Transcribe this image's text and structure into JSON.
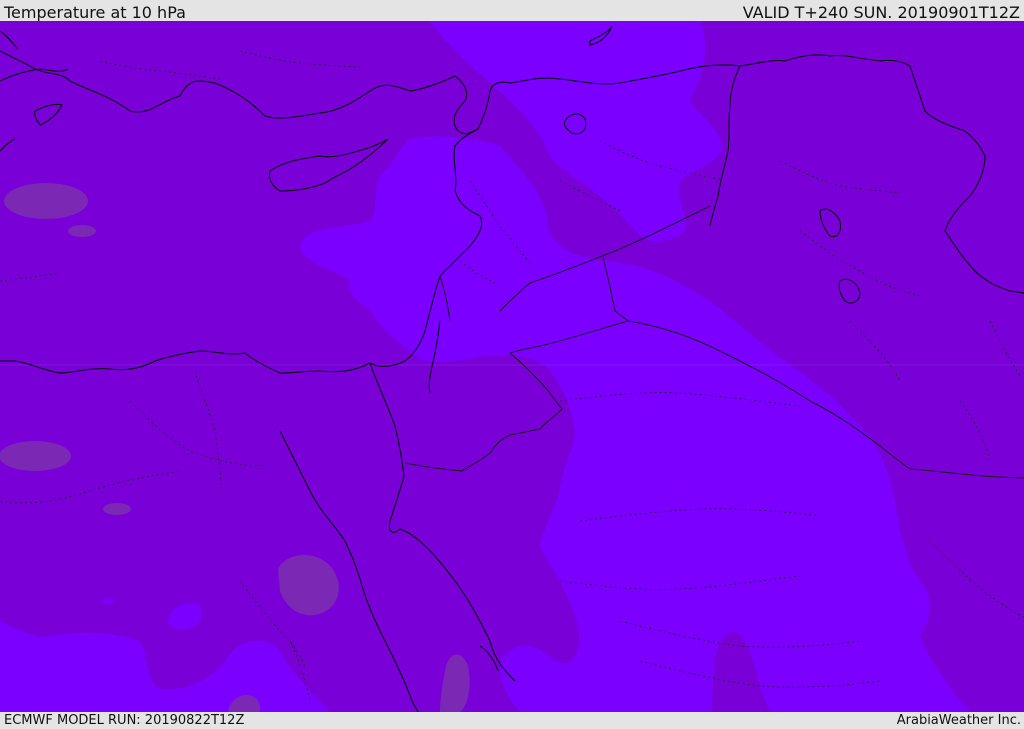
{
  "header": {
    "title": "Temperature at 10 hPa",
    "valid": "VALID T+240 SUN. 20190901T12Z"
  },
  "footer": {
    "model_run": "ECMWF MODEL RUN: 20190822T12Z",
    "credit": "ArabiaWeather Inc."
  },
  "map": {
    "field": "temperature",
    "level": "10 hPa",
    "colors": {
      "base": "#7a00d8",
      "warm_band": "#7c00ff",
      "cool_patch": "#7b28b4",
      "coastline": "#000000",
      "border": "#1a1a1a"
    }
  }
}
